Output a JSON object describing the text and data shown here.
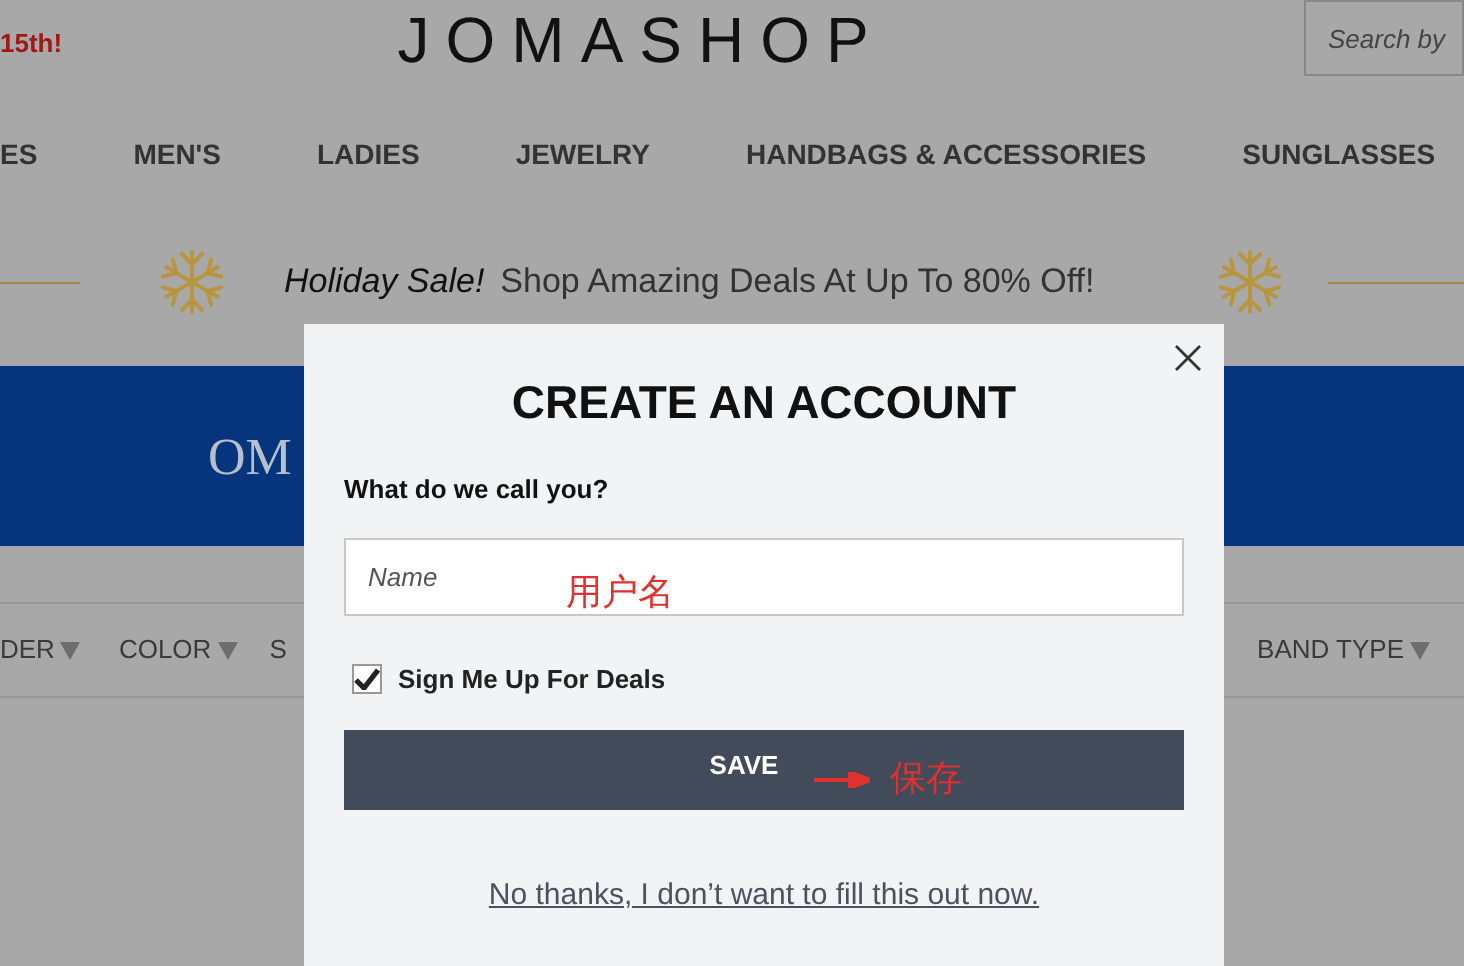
{
  "top_bar": {
    "promo_text": "15th!",
    "logo": "JOMASHOP",
    "search": {
      "placeholder": "Search by"
    }
  },
  "nav": {
    "items": [
      "ES",
      "MEN'S",
      "LADIES",
      "JEWELRY",
      "HANDBAGS & ACCESSORIES",
      "SUNGLASSES"
    ]
  },
  "promo_banner": {
    "emphasis": "Holiday Sale!",
    "text": "Shop Amazing Deals At Up To 80% Off!"
  },
  "hero": {
    "text": "OM"
  },
  "filters": {
    "items": [
      {
        "label": "DER"
      },
      {
        "label": "COLOR"
      },
      {
        "label": "S"
      },
      {
        "label": "BAND TYPE"
      }
    ]
  },
  "modal": {
    "title": "CREATE AN ACCOUNT",
    "field_label": "What do we call you?",
    "name_field": {
      "placeholder": "Name"
    },
    "deals_checkbox": {
      "label": "Sign Me Up For Deals",
      "checked": true
    },
    "save_button": "SAVE",
    "dismiss_link": "No thanks, I don’t want to fill this out now."
  },
  "annotations": [
    {
      "kind": "note",
      "text": "用户名"
    },
    {
      "kind": "arrow-note",
      "text": "保存"
    }
  ]
}
